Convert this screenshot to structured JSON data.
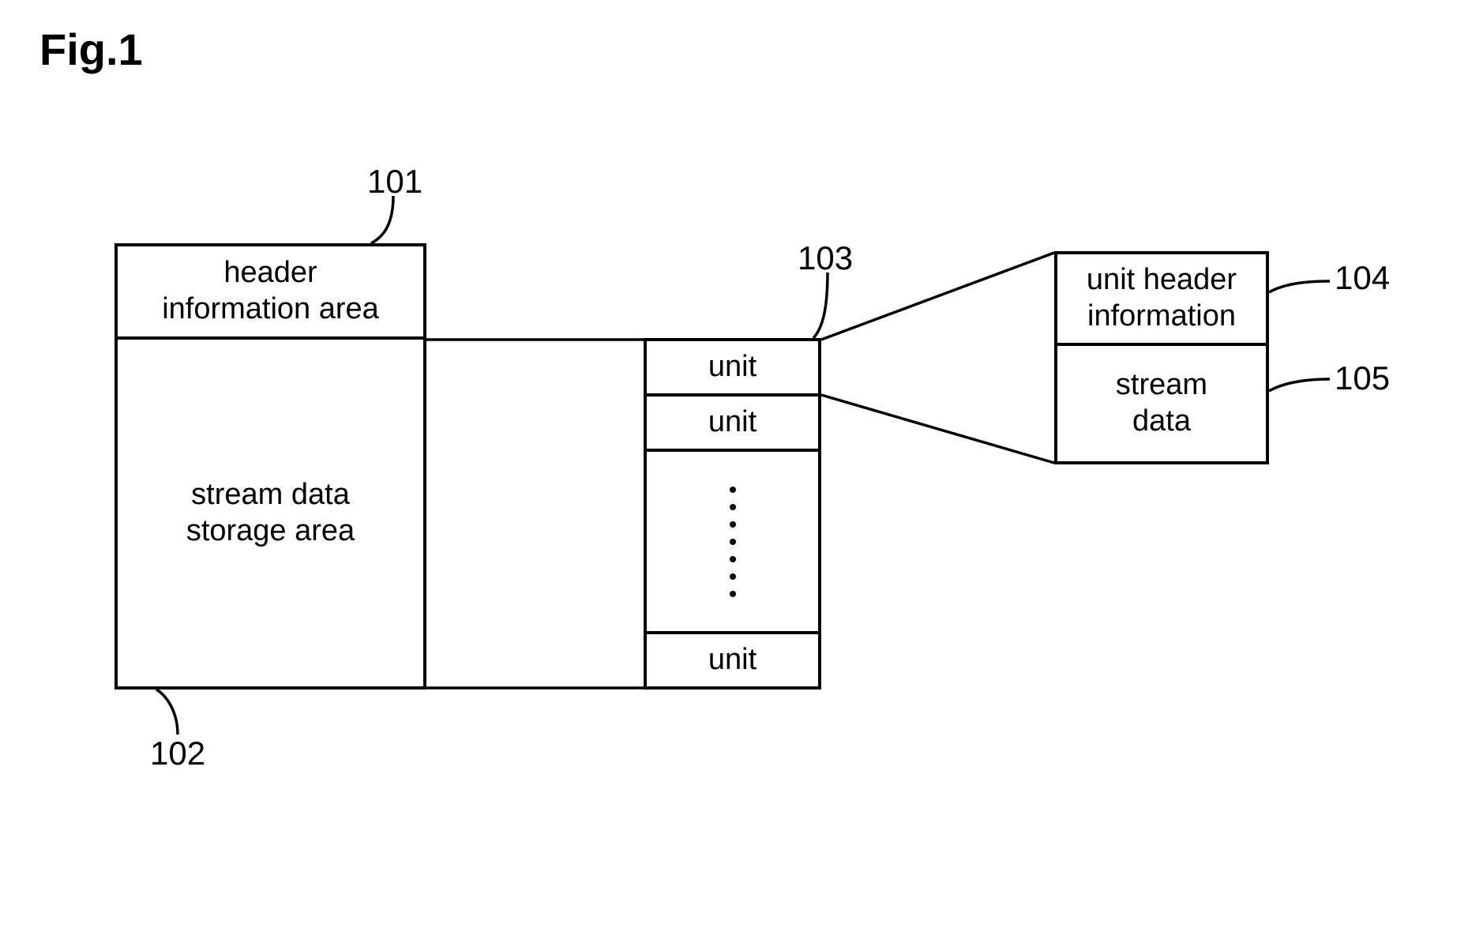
{
  "figure_title": "Fig.1",
  "refs": {
    "r101": "101",
    "r102": "102",
    "r103": "103",
    "r104": "104",
    "r105": "105"
  },
  "block1": {
    "header": "header\ninformation area",
    "storage": "stream data\nstorage area"
  },
  "block2": {
    "unit1": "unit",
    "unit2": "unit",
    "unit_last": "unit"
  },
  "block3": {
    "unit_header": "unit header\ninformation",
    "stream_data": "stream\ndata"
  }
}
